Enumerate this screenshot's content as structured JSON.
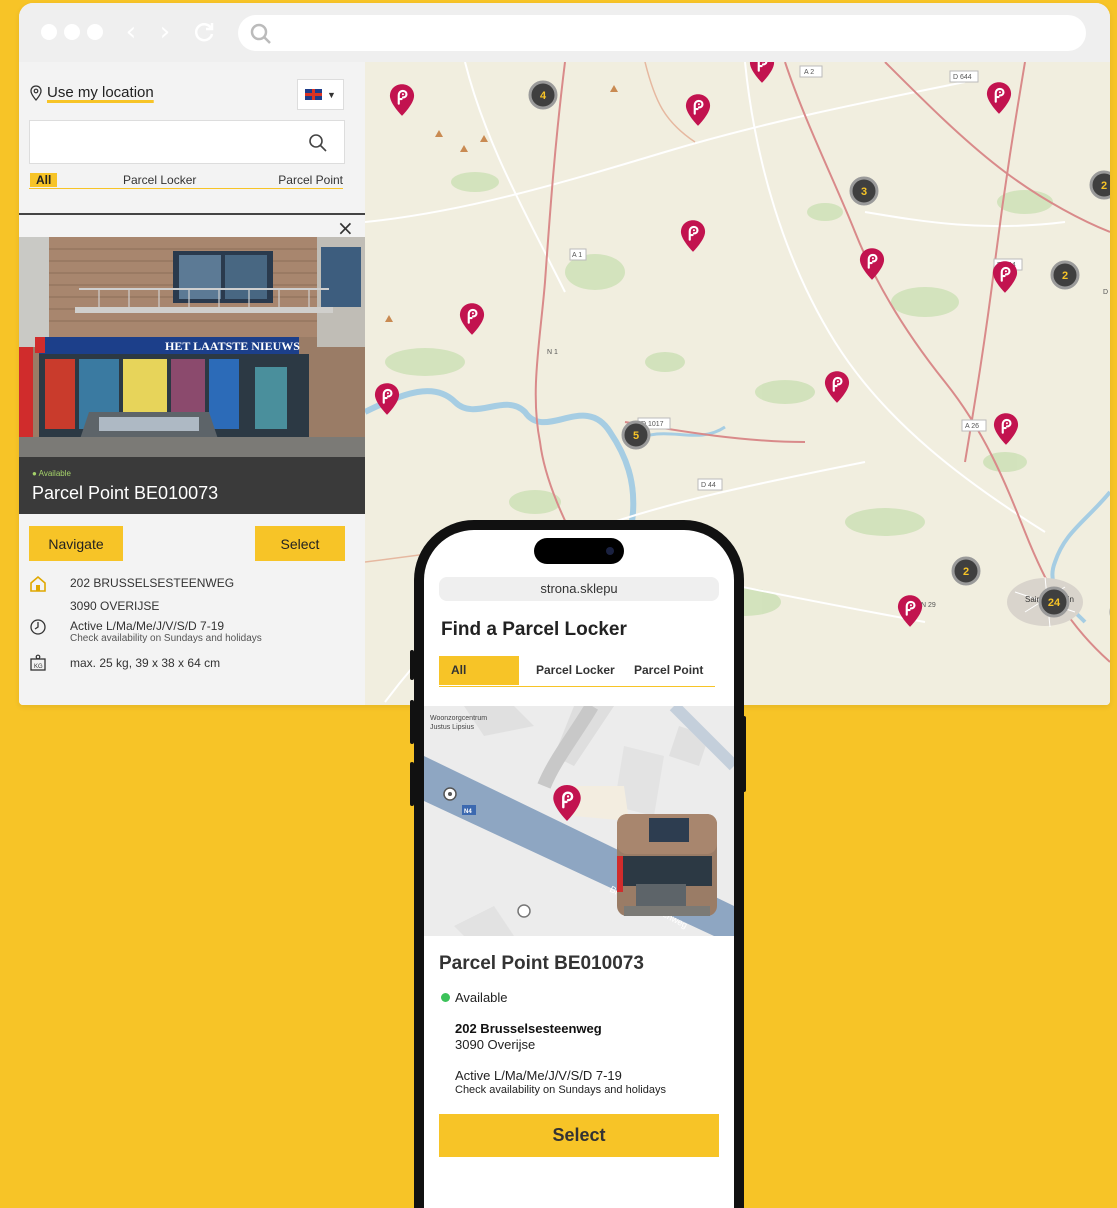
{
  "colors": {
    "accent": "#f7c427",
    "pin": "#c2134f",
    "available": "#3cc25a"
  },
  "browser": {
    "icons": [
      "back-icon",
      "forward-icon",
      "reload-icon",
      "search-icon"
    ]
  },
  "panel": {
    "use_location": "Use my location",
    "search_placeholder": "",
    "tabs": {
      "all": "All",
      "parcel_locker": "Parcel Locker",
      "parcel_point": "Parcel Point"
    },
    "status": "Available",
    "title": "Parcel Point BE010073",
    "shop_sign": "HET LAATSTE NIEUWS",
    "navigate": "Navigate",
    "select": "Select",
    "address_line1": "202 BRUSSELSESTEENWEG",
    "address_line2": "3090 OVERIJSE",
    "hours": "Active L/Ma/Me/J/V/S/D 7-19",
    "hours_note": "Check availability on Sundays and holidays",
    "capacity": "max. 25 kg, 39 x 38 x 64 cm"
  },
  "map": {
    "road_labels": [
      "A 2",
      "D 644",
      "A 1",
      "N 1",
      "D 1017",
      "D 44",
      "A 26",
      "D 644",
      "N 29",
      "Saint-Quentin",
      "D"
    ],
    "clusters": [
      "4",
      "3",
      "2",
      "2",
      "5",
      "2",
      "24"
    ]
  },
  "phone": {
    "url": "strona.sklepu",
    "heading": "Find a Parcel Locker",
    "tabs": {
      "all": "All",
      "parcel_locker": "Parcel Locker",
      "parcel_point": "Parcel Point"
    },
    "map_labels": {
      "poi": "Woonzorgcentrum\nJustus Lipsius",
      "road_tag": "N4",
      "street_start": "Br",
      "street_end": "enweg"
    },
    "title": "Parcel Point BE010073",
    "status": "Available",
    "street": "202 Brusselsesteenweg",
    "city": "3090 Overijse",
    "hours": "Active L/Ma/Me/J/V/S/D 7-19",
    "hours_note": "Check availability on Sundays and holidays",
    "select": "Select"
  }
}
